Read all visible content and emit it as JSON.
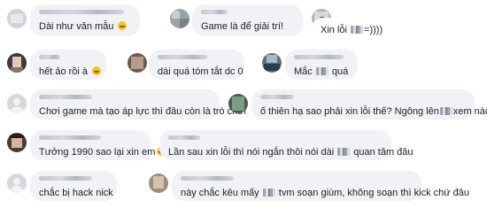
{
  "comments": [
    {
      "author": "",
      "text_before": "Dài như văn mẫu ",
      "emoji": "laughing-emoji",
      "text_after": ""
    },
    {
      "author": "",
      "text_before": "Game là để giải trí!",
      "emoji": "",
      "text_after": ""
    },
    {
      "author": "",
      "text_before": "Xin lỗi ",
      "pixel": true,
      "text_after": "=))))"
    },
    {
      "author": "",
      "text_before": "hết ảo rồi à ",
      "emoji": "laughing-emoji",
      "text_after": ""
    },
    {
      "author": "",
      "text_before": "dài quá tóm tắt dc 0",
      "text_after": ""
    },
    {
      "author": "",
      "text_before": "Mắc ",
      "pixel": true,
      "text_after": " quá"
    },
    {
      "author": "",
      "text_before": "Chơi game mà tạo áp lực thì đâu còn là trò chơi",
      "text_after": ""
    },
    {
      "author": "",
      "text_before": "ố thiên hạ sao phải xin lỗi thế? Ngông lên",
      "pixel": true,
      "text_after": "xem nào=))"
    },
    {
      "author": "",
      "text_before": "Tưởng 1990 sao lại xin em",
      "emoji": "grinning-emoji",
      "text_after": ""
    },
    {
      "author": "",
      "text_before": "Lần sau xin lỗi thì nói ngắn thôi nói dài ",
      "pixel": true,
      "text_after": " quan tâm đâu"
    },
    {
      "author": "",
      "text_before": "chắc bị hack nick",
      "text_after": ""
    },
    {
      "author": "",
      "text_before": "này chắc kêu mấy ",
      "pixel": true,
      "text_after": " tvm soạn giùm, không soạn thì kick chứ đâu"
    }
  ],
  "colors": {
    "bubble": "#f0f2f5",
    "text": "#1c1e21",
    "emoji": "#f7c12b"
  }
}
